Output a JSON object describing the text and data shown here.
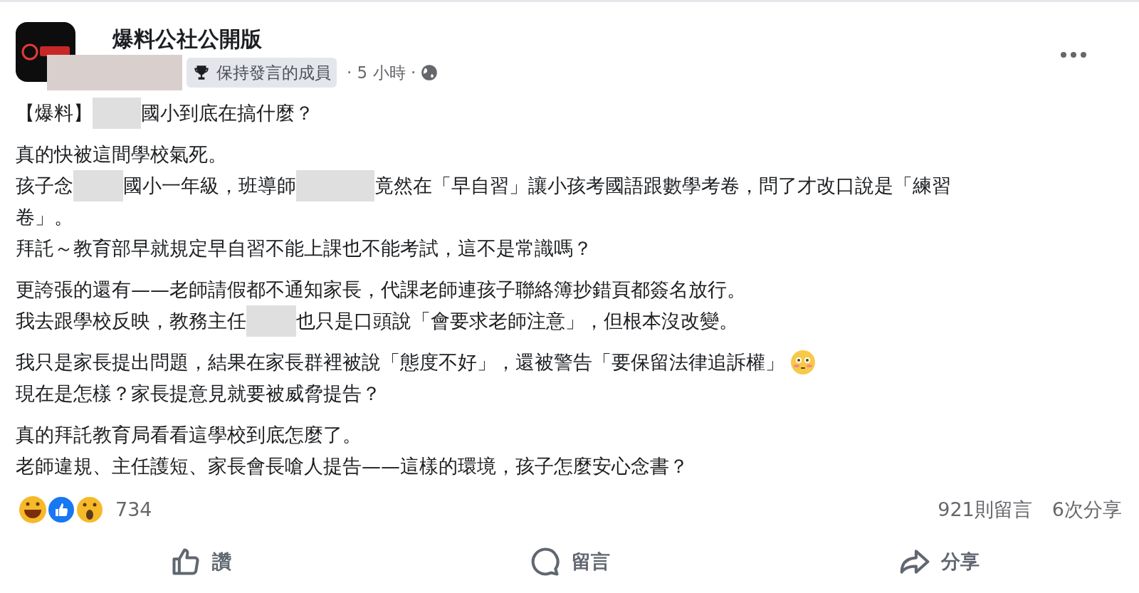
{
  "page": {
    "name": "爆料公社公開版",
    "badge": "保持發言的成員",
    "time": "· 5 小時 ·"
  },
  "post": {
    "title": [
      {
        "kind": "text",
        "text": "【爆料】"
      },
      {
        "kind": "redaction"
      },
      {
        "kind": "text",
        "text": "國小到底在搞什麼？"
      }
    ],
    "paragraphs": [
      [
        [
          {
            "kind": "text",
            "text": "真的快被這間學校氣死。"
          }
        ],
        [
          {
            "kind": "text",
            "text": "孩子念"
          },
          {
            "kind": "redaction"
          },
          {
            "kind": "text",
            "text": "國小一年級，班導師"
          },
          {
            "kind": "redaction"
          },
          {
            "kind": "text",
            "text": "竟然在「早自習」讓小孩考國語跟數學考卷，問了才改口說是「練習"
          }
        ],
        [
          {
            "kind": "text",
            "text": "卷」。"
          }
        ],
        [
          {
            "kind": "text",
            "text": "拜託～教育部早就規定早自習不能上課也不能考試，這不是常識嗎？"
          }
        ]
      ],
      [
        [
          {
            "kind": "text",
            "text": "更誇張的還有——老師請假都不通知家長，代課老師連孩子聯絡簿抄錯頁都簽名放行。"
          }
        ],
        [
          {
            "kind": "text",
            "text": "我去跟學校反映，教務主任"
          },
          {
            "kind": "redaction"
          },
          {
            "kind": "text",
            "text": "也只是口頭說「會要求老師注意」，但根本沒改變。"
          }
        ]
      ],
      [
        [
          {
            "kind": "text",
            "text": "我只是家長提出問題，結果在家長群裡被說「態度不好」，還被警告「要保留法律追訴權」"
          },
          {
            "kind": "emoji"
          }
        ],
        [
          {
            "kind": "text",
            "text": "現在是怎樣？家長提意見就要被威脅提告？"
          }
        ]
      ],
      [
        [
          {
            "kind": "text",
            "text": "真的拜託教育局看看這學校到底怎麼了。"
          }
        ],
        [
          {
            "kind": "text",
            "text": "老師違規、主任護短、家長會長嗆人提告——這樣的環境，孩子怎麼安心念書？"
          }
        ]
      ]
    ]
  },
  "reactions": {
    "count": "734",
    "comments": "921則留言",
    "shares": "6次分享"
  },
  "actions": [
    {
      "kind": "like",
      "label": "讚"
    },
    {
      "kind": "comment",
      "label": "留言"
    },
    {
      "kind": "share",
      "label": "分享"
    }
  ]
}
